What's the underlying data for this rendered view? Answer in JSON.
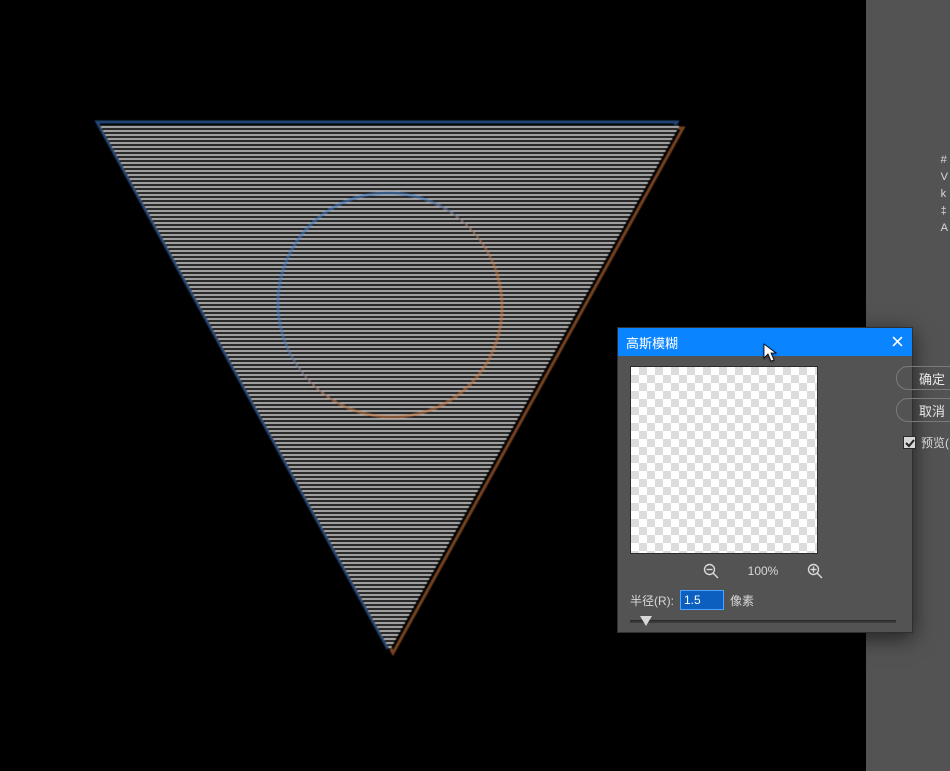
{
  "dialog": {
    "title": "高斯模糊",
    "ok_label": "确定",
    "cancel_label": "取消",
    "preview_label": "预览(P)",
    "preview_checked": true,
    "zoom_percent": "100%",
    "radius_label": "半径(R):",
    "radius_value": "1.5",
    "radius_unit": "像素"
  },
  "right_tools": {
    "items": [
      "#",
      "V",
      "k",
      "‡",
      "A"
    ]
  }
}
